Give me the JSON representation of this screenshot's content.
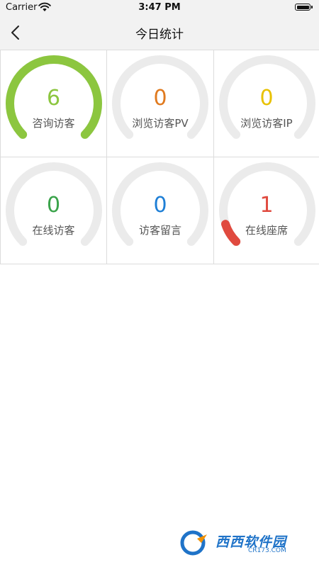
{
  "status_bar": {
    "carrier": "Carrier",
    "time": "3:47 PM"
  },
  "nav": {
    "title": "今日统计",
    "back_icon": "chevron-left-icon"
  },
  "stats": [
    {
      "id": "consult-visitors",
      "label": "咨询访客",
      "value": 6,
      "max": 6,
      "color": "#8cc63f"
    },
    {
      "id": "browse-pv",
      "label": "浏览访客PV",
      "value": 0,
      "max": 1,
      "color": "#e07a1f"
    },
    {
      "id": "browse-ip",
      "label": "浏览访客IP",
      "value": 0,
      "max": 1,
      "color": "#e8c100"
    },
    {
      "id": "online-visitors",
      "label": "在线访客",
      "value": 0,
      "max": 1,
      "color": "#3aa34a"
    },
    {
      "id": "visitor-messages",
      "label": "访客留言",
      "value": 0,
      "max": 1,
      "color": "#1e7fd6"
    },
    {
      "id": "online-seats",
      "label": "在线座席",
      "value": 1,
      "max": 10,
      "color": "#e04a3f"
    }
  ],
  "theme": {
    "track_color": "#ebebeb"
  },
  "watermark": {
    "text": "西西软件园",
    "sub": "CR173.COM"
  }
}
